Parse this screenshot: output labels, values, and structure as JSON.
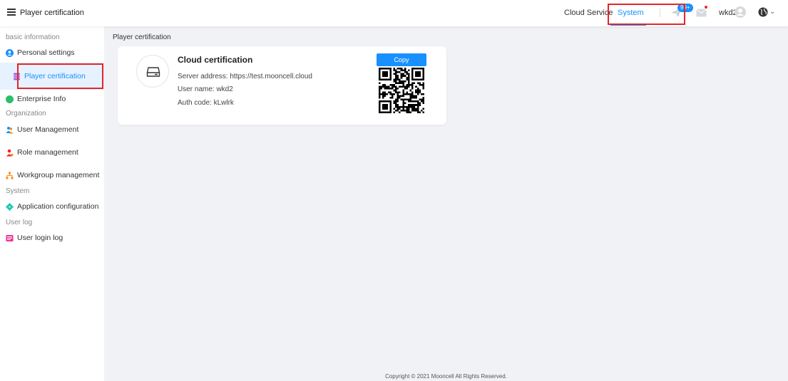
{
  "header": {
    "title": "Player certification",
    "nav": {
      "cloud_service": "Cloud Service",
      "system": "System"
    },
    "notification_badge": "99+",
    "username": "wkd2",
    "icons": [
      "menu-icon",
      "paper-plane-icon",
      "mail-icon",
      "user-avatar-icon",
      "globe-icon",
      "chevron-down-icon"
    ],
    "accent_color": "#1890ff"
  },
  "sidebar": {
    "groups": [
      {
        "title": "basic information",
        "items": [
          {
            "label": "Personal settings",
            "icon": "user-circle-icon",
            "color": "#1890ff"
          },
          {
            "label": "Player certification",
            "icon": "certificate-icon",
            "color": "#9c6ade",
            "active": true
          },
          {
            "label": "Enterprise Info",
            "icon": "enterprise-icon",
            "color": "#2bbf6a"
          }
        ]
      },
      {
        "title": "Organization",
        "items": [
          {
            "label": "User Management",
            "icon": "users-icon",
            "color": "#1890ff"
          },
          {
            "label": "Role management",
            "icon": "role-icon",
            "color": "#f5222d"
          },
          {
            "label": "Workgroup management",
            "icon": "workgroup-icon",
            "color": "#fa8c16"
          }
        ]
      },
      {
        "title": "System",
        "items": [
          {
            "label": "Application configuration",
            "icon": "app-config-icon",
            "color": "#13c2c2"
          }
        ]
      },
      {
        "title": "User log",
        "items": [
          {
            "label": "User login log",
            "icon": "log-icon",
            "color": "#eb2f96"
          }
        ]
      }
    ]
  },
  "main": {
    "breadcrumb": "Player certification",
    "card": {
      "title": "Cloud certification",
      "server_address": "Server address: https://test.mooncell.cloud",
      "user_name": "User name: wkd2",
      "auth_code": "Auth code: kLwlrk",
      "copy_label": "Copy",
      "icon": "server-drive-icon"
    }
  },
  "footer": {
    "copyright": "Copyright © 2021 Mooncell All Rights Reserved."
  }
}
